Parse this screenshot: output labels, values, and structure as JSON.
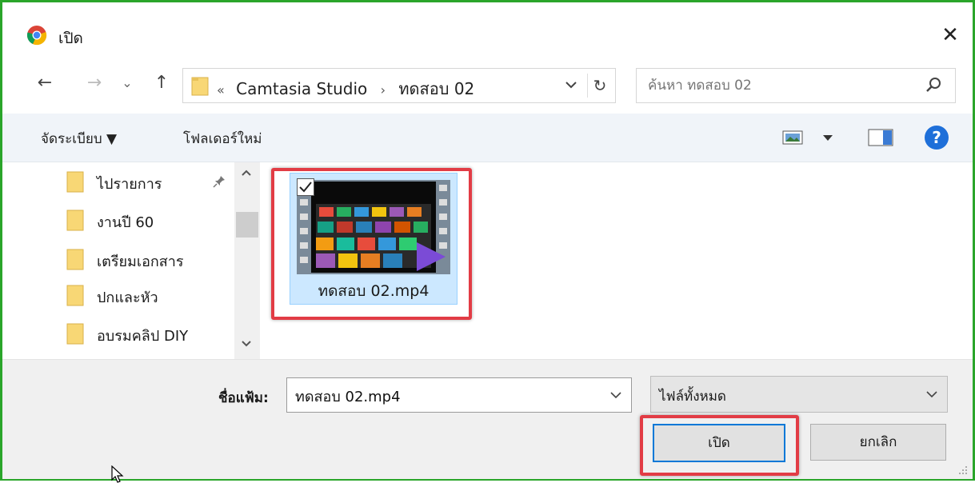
{
  "window": {
    "title": "เปิด",
    "close_glyph": "✕"
  },
  "nav": {
    "back_glyph": "←",
    "forward_glyph": "→",
    "recent_glyph": "⌄",
    "up_glyph": "↑",
    "address": {
      "overflow": "«",
      "crumb1": "Camtasia Studio",
      "separator": "›",
      "crumb2": "ทดสอบ 02"
    },
    "refresh_glyph": "↻",
    "search_placeholder": "ค้นหา ทดสอบ 02"
  },
  "toolbar": {
    "organize": "จัดระเบียบ ▼",
    "new_folder": "โฟลเดอร์ใหม่"
  },
  "sidebar": {
    "items": [
      {
        "label": "ไปรายการ"
      },
      {
        "label": "งานปี 60"
      },
      {
        "label": "เตรียมเอกสาร"
      },
      {
        "label": "ปกและหัว"
      },
      {
        "label": "อบรมคลิป DIY"
      }
    ],
    "pin_glyph": "📌"
  },
  "files": [
    {
      "name": "ทดสอบ 02.mp4",
      "selected": true
    }
  ],
  "footer": {
    "filename_label": "ชื่อแฟ้ม:",
    "filename_value": "ทดสอบ 02.mp4",
    "filter_value": "ไฟล์ทั้งหมด",
    "open_label": "เปิด",
    "cancel_label": "ยกเลิก"
  },
  "colors": {
    "accent": "#0078d7",
    "highlight_border": "#e23c45",
    "frame": "#2aa52a",
    "selection": "#cce8ff"
  }
}
